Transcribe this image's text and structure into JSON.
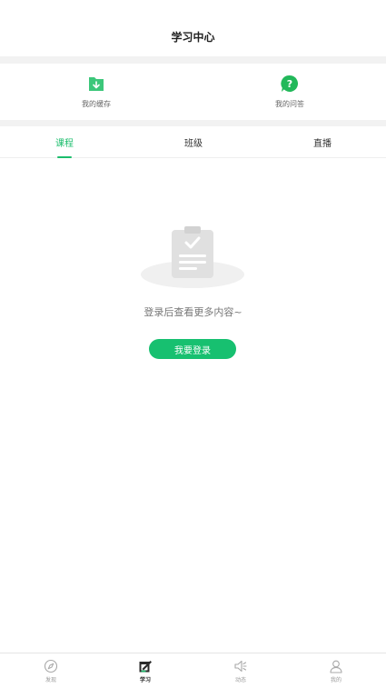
{
  "header": {
    "title": "学习中心"
  },
  "quick_actions": [
    {
      "label": "我的缓存",
      "icon": "download-folder-icon",
      "color": "#3cc77a"
    },
    {
      "label": "我的问答",
      "icon": "question-bubble-icon",
      "color": "#22b85a"
    }
  ],
  "tabs": [
    {
      "label": "课程",
      "active": true
    },
    {
      "label": "班级",
      "active": false
    },
    {
      "label": "直播",
      "active": false
    }
  ],
  "empty_state": {
    "icon": "clipboard-check-icon",
    "message": "登录后查看更多内容~",
    "button_label": "我要登录"
  },
  "bottom_nav": [
    {
      "label": "发现",
      "icon": "compass-icon",
      "active": false
    },
    {
      "label": "学习",
      "icon": "edit-notebook-icon",
      "active": true
    },
    {
      "label": "动态",
      "icon": "speaker-icon",
      "active": false
    },
    {
      "label": "我的",
      "icon": "person-icon",
      "active": false
    }
  ],
  "colors": {
    "accent": "#1bbd6c",
    "divider": "#f2f2f2"
  }
}
